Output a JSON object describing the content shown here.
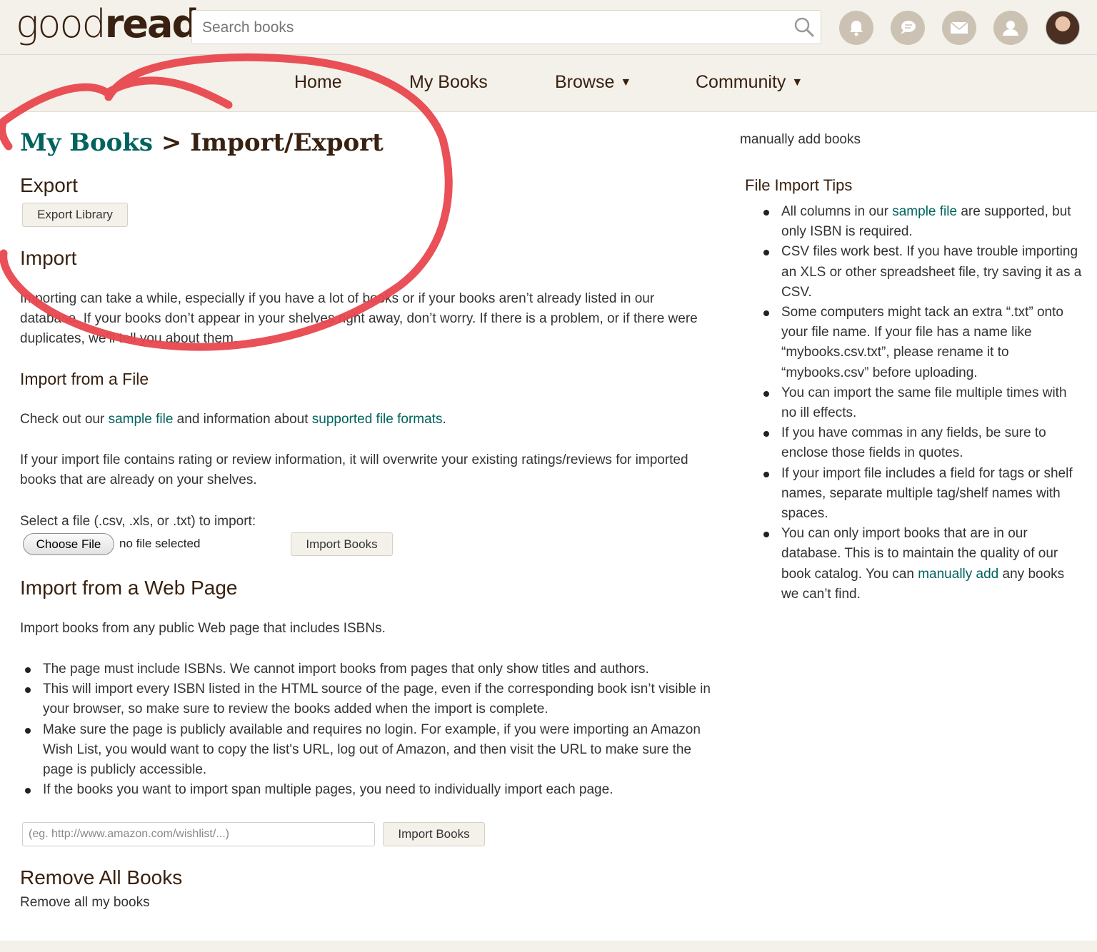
{
  "header": {
    "logo_good": "good",
    "logo_reads": "reads",
    "search_placeholder": "Search books",
    "icons": [
      "bell-icon",
      "chat-icon",
      "mail-icon",
      "friends-icon",
      "avatar"
    ]
  },
  "nav": {
    "home": "Home",
    "my_books": "My Books",
    "browse": "Browse",
    "community": "Community",
    "caret": "▼"
  },
  "page": {
    "crumb": "My Books",
    "separator": ">",
    "title": "Import/Export"
  },
  "export": {
    "heading": "Export",
    "button": "Export Library"
  },
  "import": {
    "heading": "Import",
    "intro": "Importing can take a while, especially if you have a lot of books or if your books aren’t already listed in our database. If your books don’t appear in your shelves right away, don’t worry. If there is a problem, or if there were duplicates, we’ll tell you about them.",
    "file_heading": "Import from a File",
    "check_prefix": "Check out our ",
    "sample_file_link": "sample file",
    "check_middle": " and information about ",
    "formats_link": "supported file formats",
    "check_suffix": ".",
    "overwrite_note": "If your import file contains rating or review information, it will overwrite your existing ratings/reviews for imported books that are already on your shelves.",
    "select_label": "Select a file (.csv, .xls, or .txt) to import:",
    "choose_button": "Choose File",
    "no_file": "no file selected",
    "import_button": "Import Books"
  },
  "web_import": {
    "heading": "Import from a Web Page",
    "intro": "Import books from any public Web page that includes ISBNs.",
    "bullets": [
      "The page must include ISBNs. We cannot import books from pages that only show titles and authors.",
      "This will import every ISBN listed in the HTML source of the page, even if the corresponding book isn’t visible in your browser, so make sure to review the books added when the import is complete.",
      "Make sure the page is publicly available and requires no login. For example, if you were importing an Amazon Wish List, you would want to copy the list's URL, log out of Amazon, and then visit the URL to make sure the page is publicly accessible.",
      "If the books you want to import span multiple pages, you need to individually import each page."
    ],
    "url_placeholder": "(eg. http://www.amazon.com/wishlist/...)",
    "import_button": "Import Books"
  },
  "remove": {
    "heading": "Remove All Books",
    "link": "Remove all my books"
  },
  "sidebar": {
    "manual_link": "manually add books",
    "tips_heading": "File Import Tips",
    "tip1_prefix": "All columns in our ",
    "tip1_link": "sample file",
    "tip1_suffix": " are supported, but only ISBN is required.",
    "tip2": "CSV files work best. If you have trouble importing an XLS or other spreadsheet file, try saving it as a CSV.",
    "tip3": "Some computers might tack an extra “.txt” onto your file name. If your file has a name like “mybooks.csv.txt”, please rename it to “mybooks.csv” before uploading.",
    "tip4": "You can import the same file multiple times with no ill effects.",
    "tip5": "If you have commas in any fields, be sure to enclose those fields in quotes.",
    "tip6": "If your import file includes a field for tags or shelf names, separate multiple tag/shelf names with spaces.",
    "tip7_prefix": "You can only import books that are in our database. This is to maintain the quality of our book catalog. You can ",
    "tip7_link": "manually add",
    "tip7_suffix": " any books we can’t find."
  },
  "colors": {
    "brand_brown": "#382110",
    "link_green": "#00635d",
    "bar_beige": "#f4f1ea",
    "annotation_red": "#e8474e"
  }
}
